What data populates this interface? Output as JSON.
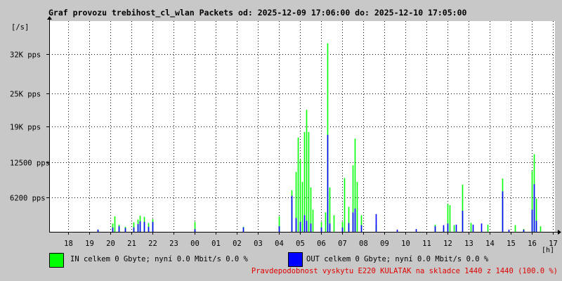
{
  "title": "Graf provozu trebihost_cl_wlan Packets od: 2025-12-09 17:06:00 do: 2025-12-10 17:05:00",
  "footer": "Pravdepodobnost vyskytu E220 KULATAK na skladce 1440 z 1440 (100.0 %)",
  "legend": {
    "in": {
      "text": "IN celkem 0 Gbyte; nyní   0.0 Mbit/s 0.0 %",
      "color": "#00ff00"
    },
    "out": {
      "text": "OUT celkem 0 Gbyte; nyní   0.0 Mbit/s 0.0 %",
      "color": "#0000ff"
    }
  },
  "chart_data": {
    "type": "area",
    "title": "Graf provozu trebihost_cl_wlan Packets od: 2025-12-09 17:06:00 do: 2025-12-10 17:05:00",
    "ylabel": "[/s]",
    "xlabel": "[h]",
    "ylim": [
      0,
      38000
    ],
    "y_ticks": [
      {
        "value": 6200,
        "label": "6200 pps"
      },
      {
        "value": 12500,
        "label": "12500 pps"
      },
      {
        "value": 19000,
        "label": "19K pps"
      },
      {
        "value": 25000,
        "label": "25K pps"
      },
      {
        "value": 32000,
        "label": "32K pps"
      }
    ],
    "x_ticks": [
      "18",
      "19",
      "20",
      "21",
      "22",
      "23",
      "00",
      "01",
      "02",
      "03",
      "04",
      "05",
      "06",
      "07",
      "08",
      "09",
      "10",
      "11",
      "12",
      "13",
      "14",
      "15",
      "16",
      "17"
    ],
    "x_range_hours": [
      17.1,
      41.1
    ],
    "grid": true,
    "series": [
      {
        "name": "IN",
        "color": "#00ff00",
        "points": [
          [
            19.4,
            400
          ],
          [
            20.1,
            1500
          ],
          [
            20.2,
            2800
          ],
          [
            20.4,
            1300
          ],
          [
            20.7,
            900
          ],
          [
            21.1,
            1700
          ],
          [
            21.3,
            2200
          ],
          [
            21.4,
            2900
          ],
          [
            21.6,
            2700
          ],
          [
            21.8,
            1600
          ],
          [
            22.0,
            2300
          ],
          [
            24.0,
            1800
          ],
          [
            26.3,
            900
          ],
          [
            28.0,
            2800
          ],
          [
            28.6,
            7500
          ],
          [
            28.8,
            10800
          ],
          [
            28.9,
            17000
          ],
          [
            29.0,
            13000
          ],
          [
            29.1,
            9000
          ],
          [
            29.2,
            18000
          ],
          [
            29.3,
            22000
          ],
          [
            29.4,
            18000
          ],
          [
            29.5,
            8000
          ],
          [
            29.6,
            4000
          ],
          [
            30.0,
            1800
          ],
          [
            30.2,
            3500
          ],
          [
            30.3,
            34000
          ],
          [
            30.4,
            8000
          ],
          [
            30.6,
            3000
          ],
          [
            31.0,
            1800
          ],
          [
            31.1,
            9700
          ],
          [
            31.3,
            4500
          ],
          [
            31.5,
            12000
          ],
          [
            31.6,
            16800
          ],
          [
            31.7,
            9000
          ],
          [
            31.9,
            3000
          ],
          [
            32.6,
            1200
          ],
          [
            35.4,
            1300
          ],
          [
            35.8,
            800
          ],
          [
            36.0,
            5000
          ],
          [
            36.1,
            4800
          ],
          [
            36.3,
            1200
          ],
          [
            36.7,
            8500
          ],
          [
            37.1,
            1600
          ],
          [
            37.9,
            1300
          ],
          [
            38.6,
            9600
          ],
          [
            39.2,
            1200
          ],
          [
            39.6,
            500
          ],
          [
            40.0,
            11000
          ],
          [
            40.1,
            14000
          ],
          [
            40.2,
            6000
          ],
          [
            40.4,
            1000
          ]
        ]
      },
      {
        "name": "OUT",
        "color": "#0000ff",
        "points": [
          [
            19.4,
            400
          ],
          [
            20.1,
            800
          ],
          [
            20.4,
            1000
          ],
          [
            20.7,
            700
          ],
          [
            21.1,
            800
          ],
          [
            21.3,
            1400
          ],
          [
            21.4,
            1900
          ],
          [
            21.6,
            1800
          ],
          [
            21.8,
            900
          ],
          [
            22.0,
            1800
          ],
          [
            24.0,
            500
          ],
          [
            26.3,
            800
          ],
          [
            28.0,
            1000
          ],
          [
            28.6,
            6500
          ],
          [
            28.8,
            2500
          ],
          [
            29.0,
            1800
          ],
          [
            29.2,
            3000
          ],
          [
            29.3,
            2000
          ],
          [
            29.5,
            1500
          ],
          [
            30.0,
            800
          ],
          [
            30.3,
            17500
          ],
          [
            30.4,
            1500
          ],
          [
            31.0,
            800
          ],
          [
            31.3,
            1600
          ],
          [
            31.5,
            3500
          ],
          [
            31.6,
            4200
          ],
          [
            31.9,
            1200
          ],
          [
            32.6,
            3200
          ],
          [
            33.6,
            400
          ],
          [
            34.5,
            500
          ],
          [
            35.4,
            1000
          ],
          [
            35.8,
            1200
          ],
          [
            36.0,
            1500
          ],
          [
            36.4,
            1300
          ],
          [
            36.7,
            3800
          ],
          [
            37.2,
            1300
          ],
          [
            37.6,
            1500
          ],
          [
            38.6,
            7300
          ],
          [
            38.9,
            400
          ],
          [
            39.6,
            400
          ],
          [
            40.0,
            4000
          ],
          [
            40.1,
            8600
          ],
          [
            40.2,
            2000
          ]
        ]
      }
    ]
  }
}
